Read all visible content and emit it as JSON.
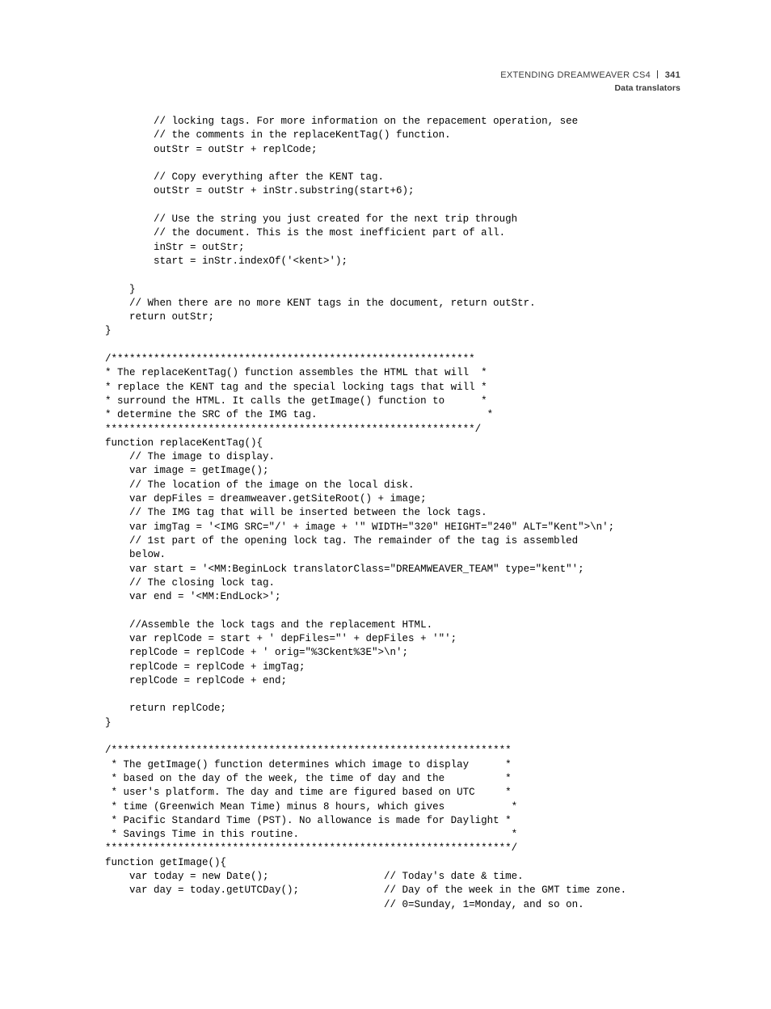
{
  "header": {
    "title": "EXTENDING DREAMWEAVER CS4",
    "page_number": "341",
    "section": "Data translators"
  },
  "code": "        // locking tags. For more information on the repacement operation, see\n        // the comments in the replaceKentTag() function.\n        outStr = outStr + replCode;\n\n        // Copy everything after the KENT tag.\n        outStr = outStr + inStr.substring(start+6);\n\n        // Use the string you just created for the next trip through\n        // the document. This is the most inefficient part of all.\n        inStr = outStr;\n        start = inStr.indexOf('<kent>');\n\n    }\n    // When there are no more KENT tags in the document, return outStr.\n    return outStr;\n}\n\n/************************************************************\n* The replaceKentTag() function assembles the HTML that will  *\n* replace the KENT tag and the special locking tags that will *\n* surround the HTML. It calls the getImage() function to      *\n* determine the SRC of the IMG tag.                            *\n*************************************************************/\nfunction replaceKentTag(){\n    // The image to display.\n    var image = getImage();\n    // The location of the image on the local disk.\n    var depFiles = dreamweaver.getSiteRoot() + image;\n    // The IMG tag that will be inserted between the lock tags.\n    var imgTag = '<IMG SRC=\"/' + image + '\" WIDTH=\"320\" HEIGHT=\"240\" ALT=\"Kent\">\\n';\n    // 1st part of the opening lock tag. The remainder of the tag is assembled\n    below.\n    var start = '<MM:BeginLock translatorClass=\"DREAMWEAVER_TEAM\" type=\"kent\"';\n    // The closing lock tag.\n    var end = '<MM:EndLock>';\n\n    //Assemble the lock tags and the replacement HTML.\n    var replCode = start + ' depFiles=\"' + depFiles + '\"';\n    replCode = replCode + ' orig=\"%3Ckent%3E\">\\n';\n    replCode = replCode + imgTag;\n    replCode = replCode + end;\n\n    return replCode;\n}\n\n/******************************************************************\n * The getImage() function determines which image to display      *\n * based on the day of the week, the time of day and the          *\n * user's platform. The day and time are figured based on UTC     *\n * time (Greenwich Mean Time) minus 8 hours, which gives           *\n * Pacific Standard Time (PST). No allowance is made for Daylight *\n * Savings Time in this routine.                                   *\n*******************************************************************/\nfunction getImage(){\n    var today = new Date();                   // Today's date & time.\n    var day = today.getUTCDay();              // Day of the week in the GMT time zone.\n                                              // 0=Sunday, 1=Monday, and so on."
}
